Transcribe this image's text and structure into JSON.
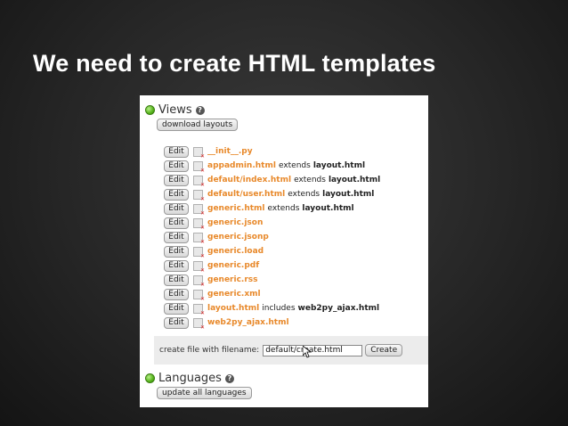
{
  "slide": {
    "title": "We need to create HTML templates"
  },
  "views": {
    "title": "Views",
    "help_icon": "?",
    "download_label": "download layouts",
    "edit_label": "Edit",
    "files": [
      {
        "name": "__init__.py",
        "relation": "",
        "target": ""
      },
      {
        "name": "appadmin.html",
        "relation": "extends",
        "target": "layout.html"
      },
      {
        "name": "default/index.html",
        "relation": "extends",
        "target": "layout.html"
      },
      {
        "name": "default/user.html",
        "relation": "extends",
        "target": "layout.html"
      },
      {
        "name": "generic.html",
        "relation": "extends",
        "target": "layout.html"
      },
      {
        "name": "generic.json",
        "relation": "",
        "target": ""
      },
      {
        "name": "generic.jsonp",
        "relation": "",
        "target": ""
      },
      {
        "name": "generic.load",
        "relation": "",
        "target": ""
      },
      {
        "name": "generic.pdf",
        "relation": "",
        "target": ""
      },
      {
        "name": "generic.rss",
        "relation": "",
        "target": ""
      },
      {
        "name": "generic.xml",
        "relation": "",
        "target": ""
      },
      {
        "name": "layout.html",
        "relation": "includes",
        "target": "web2py_ajax.html"
      },
      {
        "name": "web2py_ajax.html",
        "relation": "",
        "target": ""
      }
    ]
  },
  "create": {
    "label": "create file with filename:",
    "value": "default/create.html",
    "button_label": "Create"
  },
  "languages": {
    "title": "Languages",
    "help_icon": "?",
    "update_label": "update all languages"
  },
  "colors": {
    "file_link": "#e8892b",
    "status_dot": "#55b31a",
    "background": "#262626"
  }
}
